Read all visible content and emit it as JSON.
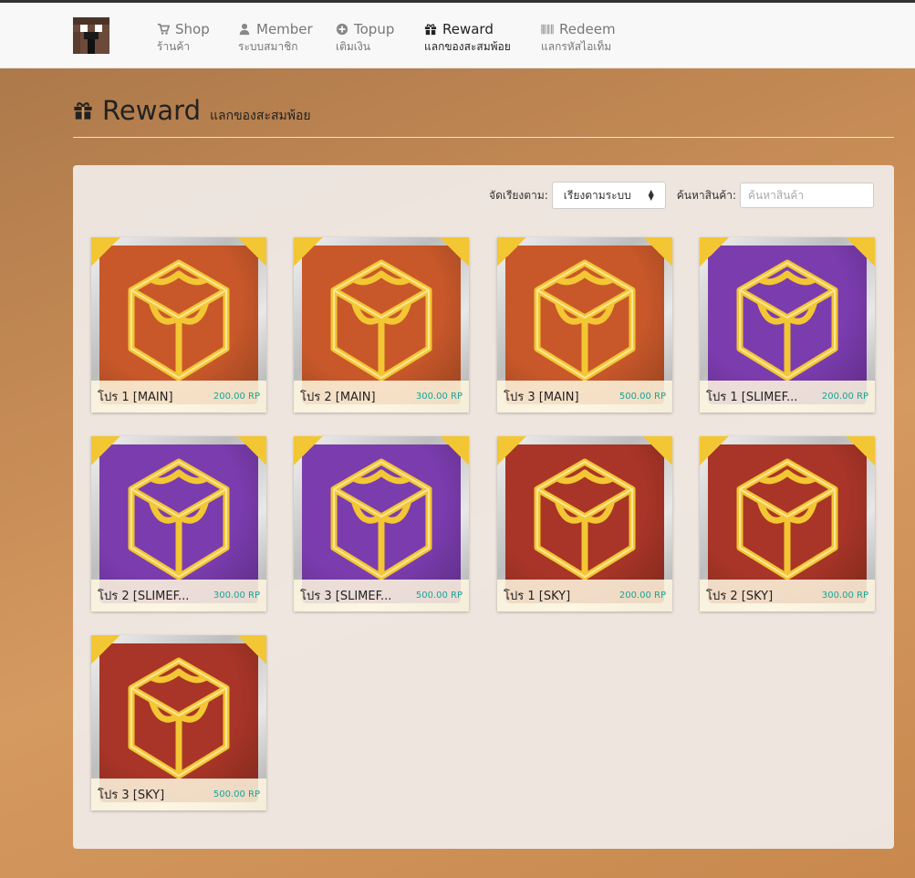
{
  "nav": {
    "items": [
      {
        "label": "Shop",
        "sub": "ร้านค้า",
        "icon": "cart-icon"
      },
      {
        "label": "Member",
        "sub": "ระบบสมาชิก",
        "icon": "user-icon"
      },
      {
        "label": "Topup",
        "sub": "เติมเงิน",
        "icon": "plus-circle-icon"
      },
      {
        "label": "Reward",
        "sub": "แลกของสะสมพ้อย",
        "icon": "gift-icon"
      },
      {
        "label": "Redeem",
        "sub": "แลกรหัสไอเท็ม",
        "icon": "barcode-icon"
      }
    ],
    "active": "Reward"
  },
  "page": {
    "title": "Reward",
    "subtitle": "แลกของสะสมพ้อย"
  },
  "filters": {
    "sort_label": "จัดเรียงตาม:",
    "sort_value": "เรียงตามระบบ",
    "search_label": "ค้นหาสินค้า:",
    "search_placeholder": "ค้นหาสินค้า"
  },
  "rewards": [
    {
      "name": "โปร 1 [MAIN]",
      "price": "200.00 RP",
      "color": "orange"
    },
    {
      "name": "โปร 2 [MAIN]",
      "price": "300.00 RP",
      "color": "orange"
    },
    {
      "name": "โปร 3 [MAIN]",
      "price": "500.00 RP",
      "color": "orange"
    },
    {
      "name": "โปร 1 [SLIMEF...",
      "price": "200.00 RP",
      "color": "purple"
    },
    {
      "name": "โปร 2 [SLIMEF...",
      "price": "300.00 RP",
      "color": "purple"
    },
    {
      "name": "โปร 3 [SLIMEF...",
      "price": "500.00 RP",
      "color": "purple"
    },
    {
      "name": "โปร 1 [SKY]",
      "price": "200.00 RP",
      "color": "red"
    },
    {
      "name": "โปร 2 [SKY]",
      "price": "300.00 RP",
      "color": "red"
    },
    {
      "name": "โปร 3 [SKY]",
      "price": "500.00 RP",
      "color": "red"
    }
  ],
  "colors": {
    "orange": "#c8582a",
    "purple": "#7b3cae",
    "red": "#a83527",
    "price": "#18a596",
    "gold": "#f3c633"
  }
}
